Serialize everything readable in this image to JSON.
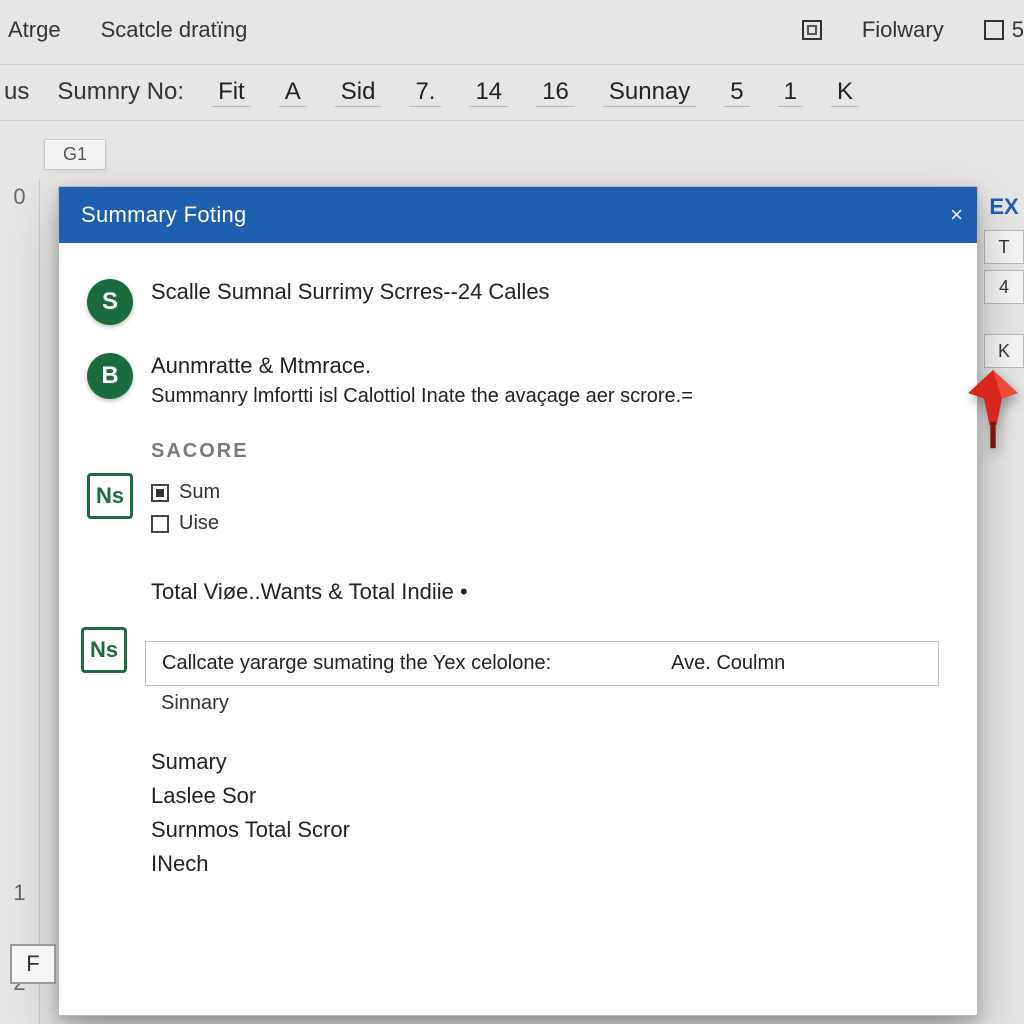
{
  "ribbon": {
    "arrange_label": "Atrge",
    "scale_label": "Scatcle dratïng",
    "followary_label": "Fiolwary",
    "extra_box_value": "5"
  },
  "toolbar2": {
    "prefix": "us",
    "summary_no_label": "Sumnry No:",
    "items": [
      "Fit",
      "A",
      "Sid",
      "7.",
      "14",
      "16",
      "Sunnay",
      "5",
      "1",
      "K"
    ]
  },
  "cell_ref": "G1",
  "row_numbers": {
    "r0": "0",
    "r1": "1",
    "r2": "2"
  },
  "right_cells": {
    "ex_label": "EX",
    "t_label": "T",
    "v1": "4",
    "v2": "K"
  },
  "dialog": {
    "title": "Summary Foting",
    "close_label": "×",
    "option_s": {
      "badge": "S",
      "title": "Scalle Sumnal Surrimy Scrres--24 Calles"
    },
    "option_b": {
      "badge": "B",
      "title": "Aunmratte & Mtmrace.",
      "subtitle": "Summanry lmfortti isl Calottiol Inate the avaçage aer scrore.="
    },
    "section_label": "SACORE",
    "ns_badge": "Ns",
    "mini_items": {
      "sum": "Sum",
      "use": "Uise"
    },
    "total_line": "Total Viøe..Wants & Total Indiie •",
    "field": {
      "left": "Callcate yararge sumating the Yex celolone:",
      "right": "Ave. Coulmn",
      "below": "Sinnary"
    },
    "ns2_badge": "Ns",
    "list": {
      "l1": "Sumary",
      "l2": "Laslee Sor",
      "l3": "Surnmos Total Scror",
      "l4": "INech"
    },
    "f_badge": "F"
  }
}
